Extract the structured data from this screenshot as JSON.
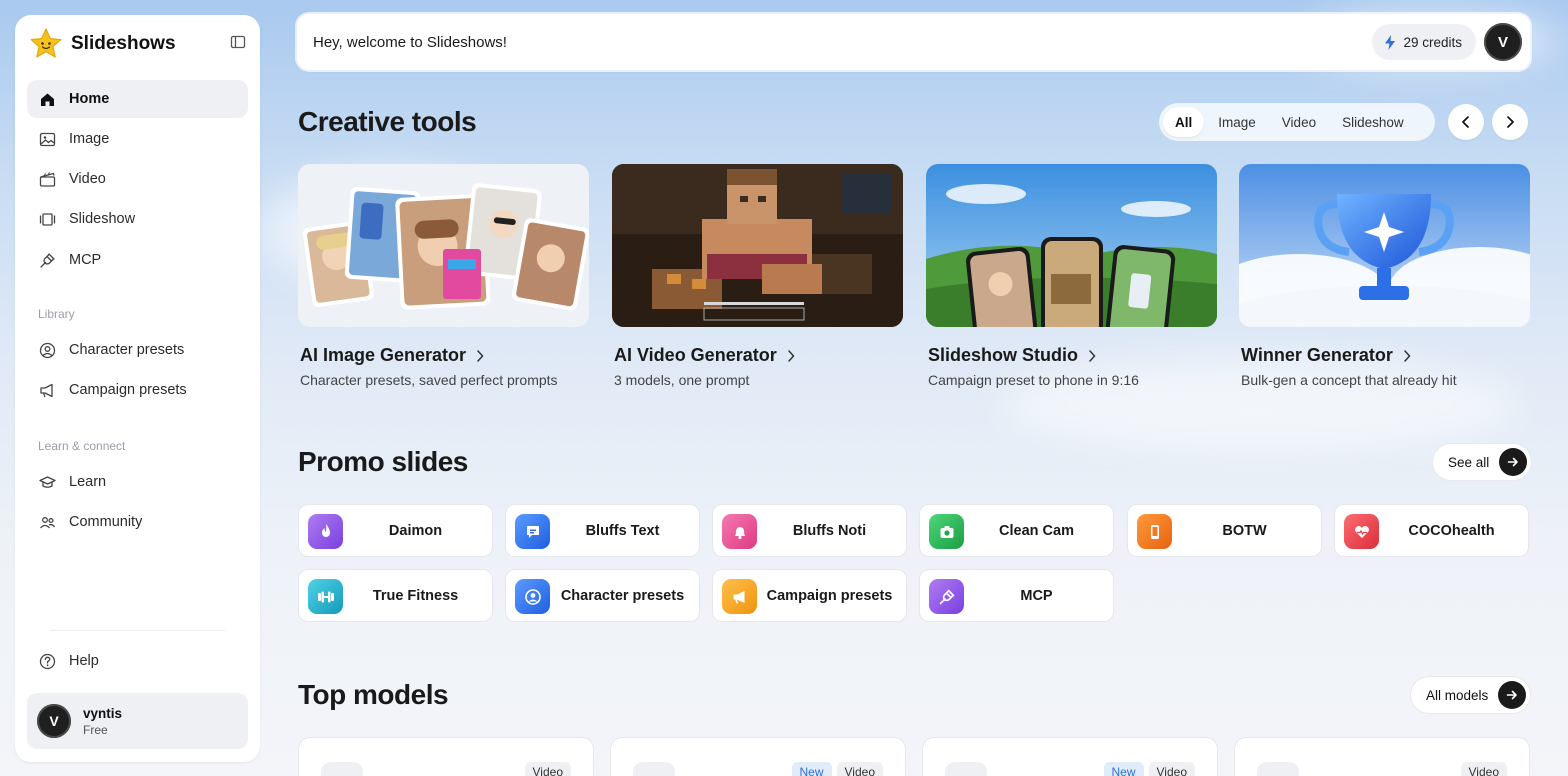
{
  "app": {
    "name": "Slideshows"
  },
  "sidebar": {
    "nav": [
      {
        "label": "Home",
        "icon": "home-icon",
        "active": true
      },
      {
        "label": "Image",
        "icon": "image-icon"
      },
      {
        "label": "Video",
        "icon": "clapperboard-icon"
      },
      {
        "label": "Slideshow",
        "icon": "slides-icon"
      },
      {
        "label": "MCP",
        "icon": "plug-icon"
      }
    ],
    "library_label": "Library",
    "library": [
      {
        "label": "Character presets",
        "icon": "user-circle-icon"
      },
      {
        "label": "Campaign presets",
        "icon": "megaphone-icon"
      }
    ],
    "learn_label": "Learn & connect",
    "learn": [
      {
        "label": "Learn",
        "icon": "graduation-cap-icon"
      },
      {
        "label": "Community",
        "icon": "users-icon"
      }
    ],
    "help_label": "Help",
    "user": {
      "initial": "V",
      "name": "vyntis",
      "plan": "Free"
    }
  },
  "topbar": {
    "welcome": "Hey, welcome to Slideshows!",
    "credits": "29 credits",
    "avatar_initial": "V"
  },
  "creative_tools": {
    "title": "Creative tools",
    "filters": [
      "All",
      "Image",
      "Video",
      "Slideshow"
    ],
    "active_filter": "All",
    "cards": [
      {
        "title": "AI Image Generator",
        "subtitle": "Character presets, saved perfect prompts"
      },
      {
        "title": "AI Video Generator",
        "subtitle": "3 models, one prompt"
      },
      {
        "title": "Slideshow Studio",
        "subtitle": "Campaign preset to phone in 9:16"
      },
      {
        "title": "Winner Generator",
        "subtitle": "Bulk-gen a concept that already hit"
      }
    ]
  },
  "promo": {
    "title": "Promo slides",
    "see_all": "See all",
    "items": [
      {
        "label": "Daimon",
        "color": "#8a4fe0"
      },
      {
        "label": "Bluffs Text",
        "color": "#2d6fe6"
      },
      {
        "label": "Bluffs Noti",
        "color": "#e3488a"
      },
      {
        "label": "Clean Cam",
        "color": "#22b24c"
      },
      {
        "label": "BOTW",
        "color": "#f07b1c"
      },
      {
        "label": "COCOhealth",
        "color": "#e8414a"
      },
      {
        "label": "True Fitness",
        "color": "#1fb4cf"
      },
      {
        "label": "Character presets",
        "color": "#2d6fe6"
      },
      {
        "label": "Campaign presets",
        "color": "#f2a11c"
      },
      {
        "label": "MCP",
        "color": "#8a4fe0"
      }
    ]
  },
  "top_models": {
    "title": "Top models",
    "all_label": "All models",
    "cards": [
      {
        "tags": [
          "Video"
        ]
      },
      {
        "tags": [
          "New",
          "Video"
        ]
      },
      {
        "tags": [
          "New",
          "Video"
        ]
      },
      {
        "tags": [
          "Video"
        ]
      }
    ]
  }
}
